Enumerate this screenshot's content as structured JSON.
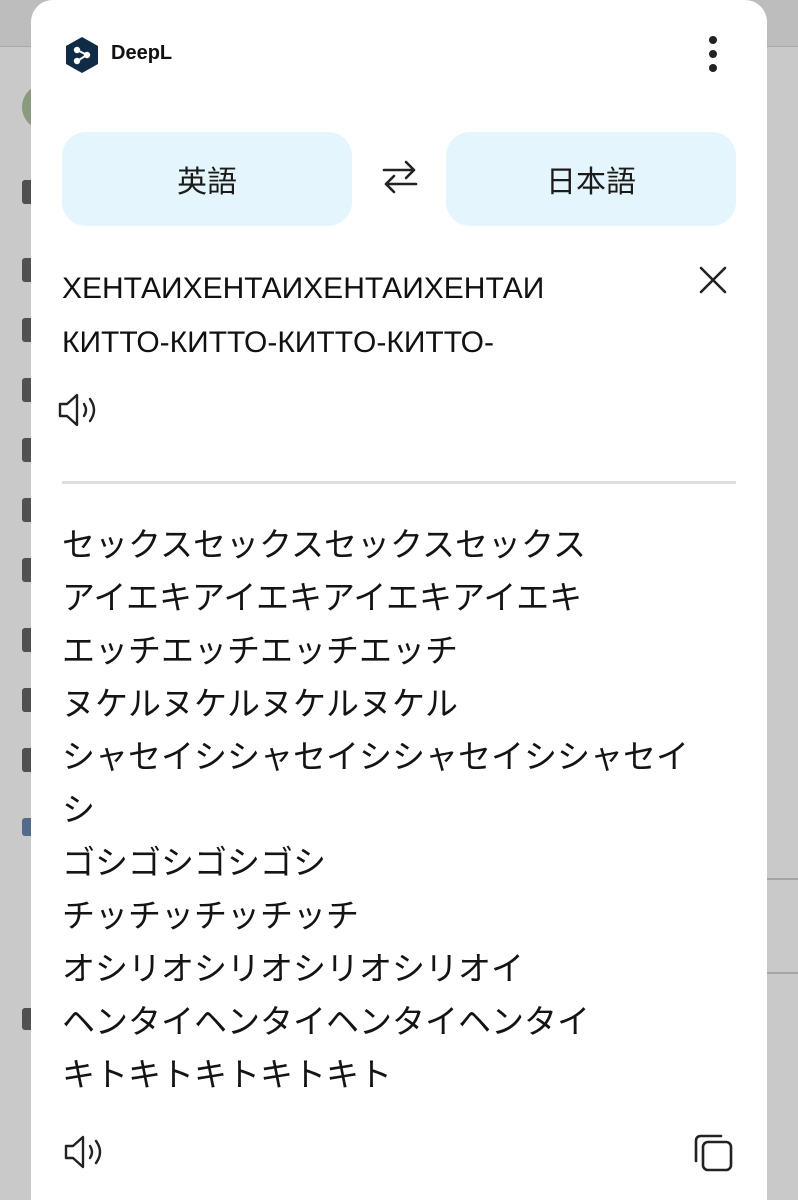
{
  "app": {
    "name": "DeepL",
    "logo_icon": "deepl-logo-icon",
    "menu_icon": "more-vertical-icon"
  },
  "languages": {
    "source": "英語",
    "target": "日本語",
    "swap_icon": "swap-arrows-icon"
  },
  "source_text": {
    "lines": [
      "ХЕНТАИХЕНТАИХЕНТАИХЕНТАИ",
      "КИТТО-КИТТО-КИТТO-КИТТО-"
    ],
    "clear_icon": "close-icon",
    "speaker_icon": "speaker-icon"
  },
  "translation": {
    "lines": [
      "セックスセックスセックスセックス",
      "アイエキアイエキアイエキアイエキ",
      "エッチエッチエッチエッチ",
      "ヌケルヌケルヌケルヌケル",
      "シャセイシシャセイシシャセイシシャセイ",
      "シ",
      "ゴシゴシゴシゴシ",
      "チッチッチッチッチ",
      "オシリオシリオシリオシリオイ",
      "ヘンタイヘンタイヘンタイヘンタイ",
      "キトキトキトキトキト"
    ],
    "speaker_icon": "speaker-icon",
    "copy_icon": "copy-icon"
  },
  "colors": {
    "lang_button_bg": "#e4f5fe",
    "divider": "#dedede",
    "text": "#111111",
    "logo": "#0f2b46"
  }
}
